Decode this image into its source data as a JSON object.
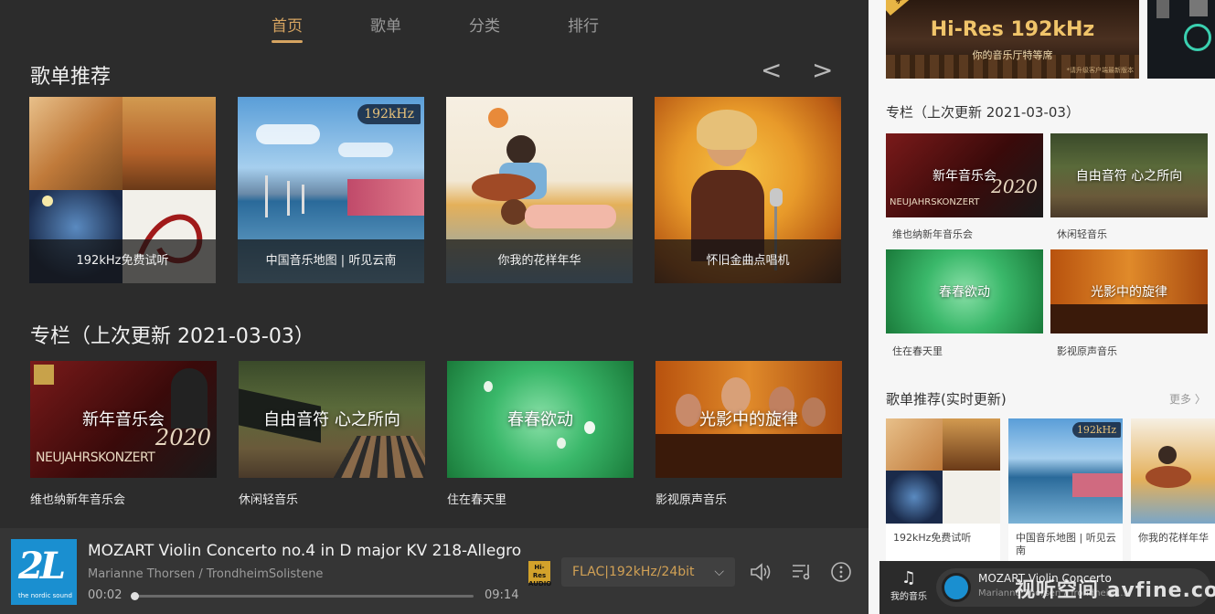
{
  "tabs": [
    {
      "label": "首页",
      "active": true
    },
    {
      "label": "歌单",
      "active": false
    },
    {
      "label": "分类",
      "active": false
    },
    {
      "label": "排行",
      "active": false
    }
  ],
  "playlists": {
    "title": "歌单推荐",
    "prev_arrow": "<",
    "next_arrow": ">",
    "items": [
      {
        "label": "192kHz免费试听"
      },
      {
        "label": "中国音乐地图 | 听见云南",
        "badge": "192kHz"
      },
      {
        "label": "你我的花样年华"
      },
      {
        "label": "怀旧金曲点唱机"
      }
    ]
  },
  "columns": {
    "title": "专栏（上次更新 2021-03-03）",
    "items": [
      {
        "title": "新年音乐会",
        "label": "维也纳新年音乐会",
        "overlay": "2020",
        "sub": "NEUJAHRSKONZERT"
      },
      {
        "title": "自由音符 心之所向",
        "label": "休闲轻音乐"
      },
      {
        "title": "春春欲动",
        "label": "住在春天里"
      },
      {
        "title": "光影中的旋律",
        "label": "影视原声音乐"
      }
    ]
  },
  "player": {
    "title": "MOZART Violin Concerto no.4 in D major KV 218-Allegro",
    "artist": "Marianne Thorsen / TrondheimSolistene",
    "elapsed": "00:02",
    "duration": "09:14",
    "progress": 0.004,
    "format": "FLAC|192kHz/24bit",
    "hires_badge": "Hi-Res AUDIO",
    "cover_text": "2L",
    "cover_sub": "the nordic sound"
  },
  "phone": {
    "banner": {
      "ribbon": "实时更新",
      "headline": "Hi-Res 192kHz",
      "tagline": "你的音乐厅特等席",
      "note": "*请升级客户端最新版本"
    },
    "columns_title": "专栏（上次更新 2021-03-03）",
    "columns": [
      {
        "title": "新年音乐会",
        "label": "维也纳新年音乐会"
      },
      {
        "title": "自由音符 心之所向",
        "label": "休闲轻音乐"
      },
      {
        "title": "春春欲动",
        "label": "住在春天里"
      },
      {
        "title": "光影中的旋律",
        "label": "影视原声音乐"
      }
    ],
    "playlists_title": "歌单推荐(实时更新)",
    "more": "更多 〉",
    "playlists": [
      {
        "label": "192kHz免费试听"
      },
      {
        "label": "中国音乐地图 | 听见云南",
        "badge": "192kHz"
      },
      {
        "label": "你我的花样年华"
      }
    ],
    "my_music": "我的音乐",
    "mini_title": "MOZART Violin Concerto",
    "mini_artist": "Marianne Thorsen / Trondheim..."
  },
  "watermark": "视听空间 avfine.com",
  "colors": {
    "accent": "#d6a461",
    "dark_bg": "#2c2c2c",
    "player_bg": "#353535",
    "light_bg": "#f6f6f6"
  }
}
